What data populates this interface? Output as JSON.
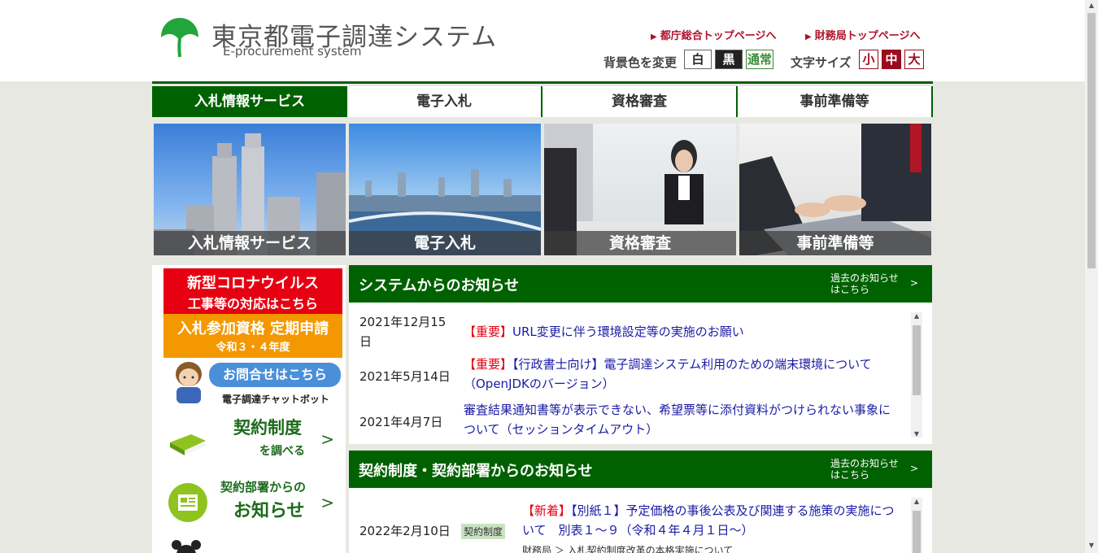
{
  "header": {
    "title": "東京都電子調達システム",
    "subtitle": "E-procurement system",
    "link_metro": "都庁総合トップページへ",
    "link_finance": "財務局トップページへ",
    "bg_label": "背景色を変更",
    "bg_white": "白",
    "bg_black": "黒",
    "bg_normal": "通常",
    "fontsize_label": "文字サイズ",
    "fs_small": "小",
    "fs_medium": "中",
    "fs_large": "大",
    "brand_color": "#006100"
  },
  "nav": {
    "tabs": [
      {
        "label": "入札情報サービス"
      },
      {
        "label": "電子入札"
      },
      {
        "label": "資格審査"
      },
      {
        "label": "事前準備等"
      }
    ]
  },
  "banners": [
    {
      "label": "入札情報サービス"
    },
    {
      "label": "電子入札"
    },
    {
      "label": "資格審査"
    },
    {
      "label": "事前準備等"
    }
  ],
  "sidebar": {
    "corona_line1": "新型コロナウイルス",
    "corona_line2": "工事等の対応はこちら",
    "qual_line1": "入札参加資格 定期申請",
    "qual_line2": "令和３・４年度",
    "chat_bubble": "お問合せはこちら",
    "chat_sub": "電子調達チャットボット",
    "contract_line1": "契約制度",
    "contract_line2": "を調べる",
    "dept_line1": "契約部署からの",
    "dept_line2": "お知らせ",
    "arrow": ">"
  },
  "system_news": {
    "title": "システムからのお知らせ",
    "past_line1": "過去のお知らせ",
    "past_line2": "はこちら",
    "past_arrow": ">",
    "items": [
      {
        "date": "2021年12月15日",
        "tag": "【重要】",
        "text": "URL変更に伴う環境設定等の実施のお願い"
      },
      {
        "date": "2021年5月14日",
        "tag": "【重要】",
        "text": "【行政書士向け】電子調達システム利用のための端末環境について（OpenJDKのバージョン）"
      },
      {
        "date": "2021年4月7日",
        "tag": "",
        "text": "審査結果通知書等が表示できない、希望票等に添付資料がつけられない事象について（セッションタイムアウト）"
      }
    ]
  },
  "contract_news": {
    "title": "契約制度・契約部署からのお知らせ",
    "past_line1": "過去のお知らせ",
    "past_line2": "はこちら",
    "past_arrow": ">",
    "items": [
      {
        "date": "2022年2月10日",
        "category": "契約制度",
        "tag": "【新着】",
        "text": "【別紙１】予定価格の事後公表及び関連する施策の実施について　別表１～９（令和４年４月１日～）",
        "sub": "財務局 ＞ 入札契約制度改革の本格実施について"
      }
    ]
  }
}
